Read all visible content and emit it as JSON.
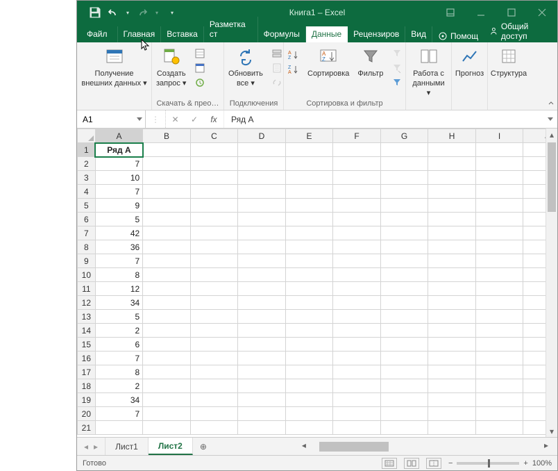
{
  "title": "Книга1 – Excel",
  "qat": {
    "save": "save",
    "undo": "undo",
    "redo": "redo"
  },
  "tabs": {
    "file": "Файл",
    "home": "Главная",
    "insert": "Вставка",
    "layout": "Разметка ст",
    "formulas": "Формулы",
    "data": "Данные",
    "review": "Рецензиров",
    "view": "Вид"
  },
  "help_label": "Помощ",
  "share_label": "Общий доступ",
  "ribbon": {
    "get_data": {
      "btn": "Получение\nвнешних данных ▾",
      "group": ""
    },
    "query": {
      "btn": "Создать\nзапрос ▾",
      "group": "Скачать & прео…"
    },
    "refresh": {
      "btn": "Обновить\nвсе ▾",
      "group": "Подключения"
    },
    "sort": {
      "btn1": "",
      "btn2": "Сортировка",
      "group": "Сортировка и фильтр"
    },
    "filter": {
      "btn": "Фильтр"
    },
    "datatools": {
      "btn": "Работа с\nданными ▾"
    },
    "forecast": {
      "btn": "Прогноз"
    },
    "outline": {
      "btn": "Структура"
    }
  },
  "namebox": "A1",
  "formula": "Ряд A",
  "columns": [
    "A",
    "B",
    "C",
    "D",
    "E",
    "F",
    "G",
    "H",
    "I",
    "J"
  ],
  "rows": [
    {
      "n": 1,
      "a": "Ряд A",
      "hdr": true
    },
    {
      "n": 2,
      "a": "7"
    },
    {
      "n": 3,
      "a": "10"
    },
    {
      "n": 4,
      "a": "7"
    },
    {
      "n": 5,
      "a": "9"
    },
    {
      "n": 6,
      "a": "5"
    },
    {
      "n": 7,
      "a": "42"
    },
    {
      "n": 8,
      "a": "36"
    },
    {
      "n": 9,
      "a": "7"
    },
    {
      "n": 10,
      "a": "8"
    },
    {
      "n": 11,
      "a": "12"
    },
    {
      "n": 12,
      "a": "34"
    },
    {
      "n": 13,
      "a": "5"
    },
    {
      "n": 14,
      "a": "2"
    },
    {
      "n": 15,
      "a": "6"
    },
    {
      "n": 16,
      "a": "7"
    },
    {
      "n": 17,
      "a": "8"
    },
    {
      "n": 18,
      "a": "2"
    },
    {
      "n": 19,
      "a": "34"
    },
    {
      "n": 20,
      "a": "7"
    },
    {
      "n": 21,
      "a": ""
    }
  ],
  "sheets": {
    "s1": "Лист1",
    "s2": "Лист2"
  },
  "status": "Готово",
  "zoom": "100%"
}
